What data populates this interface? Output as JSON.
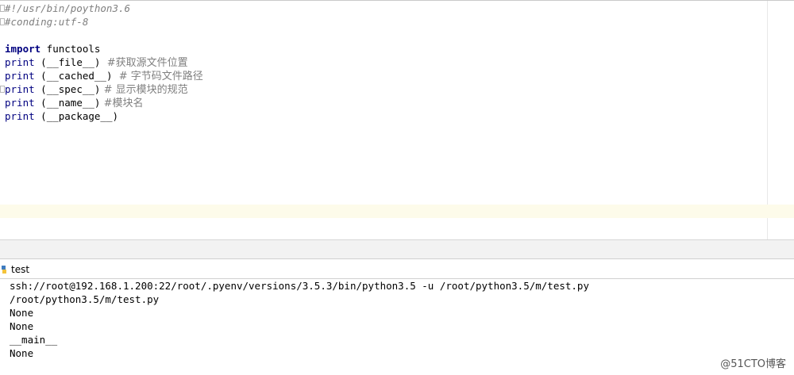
{
  "editor": {
    "lines": [
      {
        "text": "#!/usr/bin/poython3.6"
      },
      {
        "text": "#conding:utf-8"
      },
      {
        "text": ""
      },
      {
        "kw": "import",
        "rest": " functools"
      },
      {
        "fn": "print",
        "arg": " (__file__)",
        "comment": "  #获取源文件位置"
      },
      {
        "fn": "print",
        "arg": " (__cached__)",
        "comment": "  # 字节码文件路径"
      },
      {
        "fn": "print",
        "arg": " (__spec__)",
        "comment": " # 显示模块的规范"
      },
      {
        "fn": "print",
        "arg": " (__name__)",
        "comment": " #模块名"
      },
      {
        "fn": "print",
        "arg": " (__package__)",
        "comment": ""
      }
    ]
  },
  "run_panel": {
    "tab_label": "test",
    "icon": "python-file-icon",
    "output": [
      "ssh://root@192.168.1.200:22/root/.pyenv/versions/3.5.3/bin/python3.5 -u /root/python3.5/m/test.py",
      "/root/python3.5/m/test.py",
      "None",
      "None",
      "__main__",
      "None"
    ]
  },
  "watermark": "@51CTO博客"
}
